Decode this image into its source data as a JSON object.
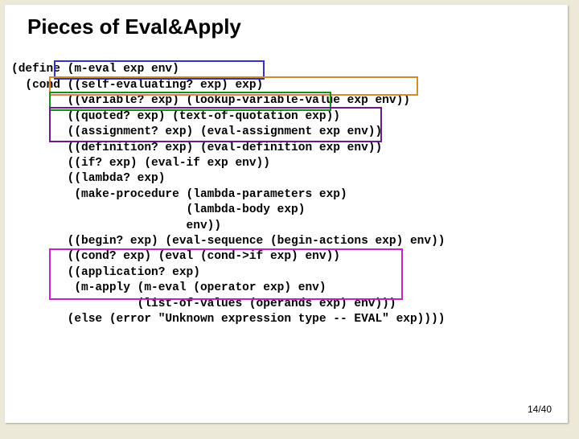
{
  "title": "Pieces of Eval&Apply",
  "code": {
    "l1": "(define (m-eval exp env)",
    "l2": "  (cond ((self-evaluating? exp) exp)",
    "l3": "        ((variable? exp) (lookup-variable-value exp env))",
    "l4": "        ((quoted? exp) (text-of-quotation exp))",
    "l5": "        ((assignment? exp) (eval-assignment exp env))",
    "l6": "        ((definition? exp) (eval-definition exp env))",
    "l7": "        ((if? exp) (eval-if exp env))",
    "l8": "        ((lambda? exp)",
    "l9": "         (make-procedure (lambda-parameters exp)",
    "l10": "                         (lambda-body exp)",
    "l11": "                         env))",
    "l12": "        ((begin? exp) (eval-sequence (begin-actions exp) env))",
    "l13": "        ((cond? exp) (eval (cond->if exp) env))",
    "l14": "        ((application? exp)",
    "l15": "         (m-apply (m-eval (operator exp) env)",
    "l16": "                  (list-of-values (operands exp) env)))",
    "l17": "        (else (error \"Unknown expression type -- EVAL\" exp))))"
  },
  "pagenum": "14/40"
}
